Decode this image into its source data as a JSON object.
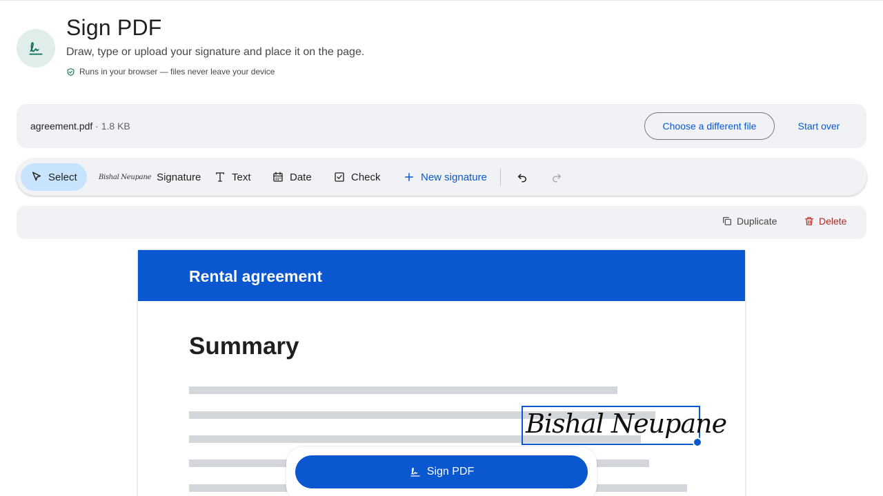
{
  "header": {
    "title": "Sign PDF",
    "subtitle": "Draw, type or upload your signature and place it on the page.",
    "privacy_note": "Runs in your browser — files never leave your device",
    "app_icon": "signature-icon"
  },
  "file": {
    "name": "agreement.pdf",
    "size": " · 1.8 KB",
    "choose_label": "Choose a different file",
    "start_over_label": "Start over"
  },
  "toolbar": {
    "tools": {
      "select": "Select",
      "signature": "Signature",
      "signature_preview": "Bishal Neupane",
      "text": "Text",
      "date": "Date",
      "check": "Check",
      "new_signature": "New signature"
    },
    "active_tool": "select"
  },
  "selection": {
    "duplicate_label": "Duplicate",
    "delete_label": "Delete"
  },
  "document": {
    "banner_title": "Rental agreement",
    "heading": "Summary",
    "placed_signature": "Bishal Neupane"
  },
  "actions": {
    "sign_label": "Sign PDF"
  },
  "colors": {
    "accent": "#0b57d0",
    "danger": "#b3261e",
    "icon_bg": "#dfeeea",
    "panel_bg": "#f0f2f5",
    "active_tool_bg": "#c7e3fd"
  }
}
